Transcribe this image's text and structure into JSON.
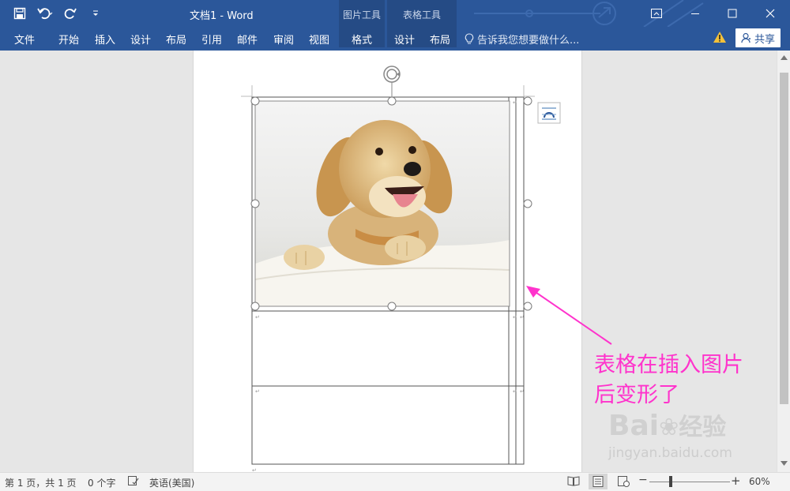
{
  "app": {
    "document_title": "文档1 - Word",
    "context_tabs": [
      "图片工具",
      "表格工具"
    ]
  },
  "ribbon": {
    "tabs": [
      "文件",
      "开始",
      "插入",
      "设计",
      "布局",
      "引用",
      "邮件",
      "审阅",
      "视图",
      "格式",
      "设计",
      "布局"
    ],
    "tell_me_placeholder": "告诉我您想要做什么...",
    "share_label": "共享"
  },
  "statusbar": {
    "page_info": "第 1 页，共 1 页",
    "word_count": "0 个字",
    "language": "英语(美国)",
    "zoom": "60%"
  },
  "annotation": {
    "line1": "表格在插入图片",
    "line2": "后变形了"
  },
  "watermark": {
    "brand": "Bai",
    "brand_suffix": "经验",
    "url": "jingyan.baidu.com"
  },
  "colors": {
    "title_bar": "#2b579a",
    "annotation": "#ff33cc"
  },
  "icons": [
    "save-icon",
    "undo-icon",
    "redo-icon",
    "customize-qat-icon",
    "ribbon-display-icon",
    "minimize-icon",
    "maximize-icon",
    "close-icon",
    "lightbulb-icon",
    "warning-icon",
    "person-icon",
    "rotate-handle-icon",
    "layout-options-icon"
  ]
}
